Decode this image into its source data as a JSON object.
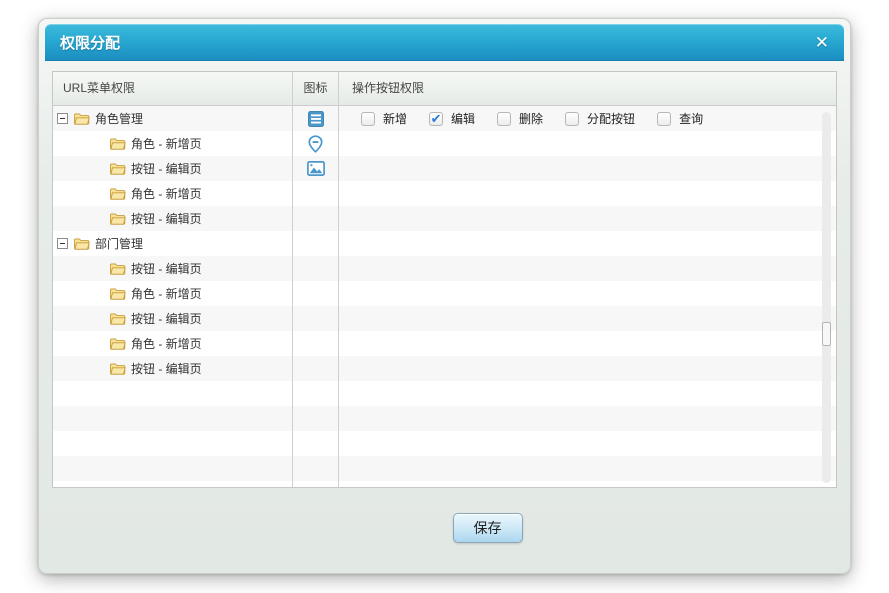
{
  "dialog": {
    "title": "权限分配",
    "close_glyph": "✕"
  },
  "table": {
    "columns": [
      {
        "label": "URL菜单权限"
      },
      {
        "label": "图标"
      },
      {
        "label": "操作按钮权限"
      }
    ],
    "tree": [
      {
        "label": "角色管理",
        "type": "parent",
        "expanded": true
      },
      {
        "label": "角色 - 新增页",
        "type": "child"
      },
      {
        "label": "按钮 - 编辑页",
        "type": "child"
      },
      {
        "label": "角色 - 新增页",
        "type": "child"
      },
      {
        "label": "按钮 - 编辑页",
        "type": "child"
      },
      {
        "label": "部门管理",
        "type": "parent",
        "expanded": true
      },
      {
        "label": "按钮 - 编辑页",
        "type": "child"
      },
      {
        "label": "角色 - 新增页",
        "type": "child"
      },
      {
        "label": "按钮 - 编辑页",
        "type": "child"
      },
      {
        "label": "角色 - 新增页",
        "type": "child"
      },
      {
        "label": "按钮 - 编辑页",
        "type": "child"
      }
    ],
    "icon_rows": [
      "list",
      "pin",
      "image"
    ],
    "action_checkboxes": [
      {
        "label": "新增",
        "checked": false
      },
      {
        "label": "编辑",
        "checked": true
      },
      {
        "label": "删除",
        "checked": false
      },
      {
        "label": "分配按钮",
        "checked": false
      },
      {
        "label": "查询",
        "checked": false
      }
    ],
    "check_glyph": "✔",
    "visible_row_count": 15
  },
  "footer": {
    "save_label": "保存"
  },
  "colors": {
    "header_top": "#3dbbde",
    "header_bottom": "#1b8ec2",
    "icon_blue": "#4a97ca",
    "check_blue": "#2b7cd9",
    "stripe": "#f6f7f6",
    "folder_gold": "#f3c95f"
  }
}
